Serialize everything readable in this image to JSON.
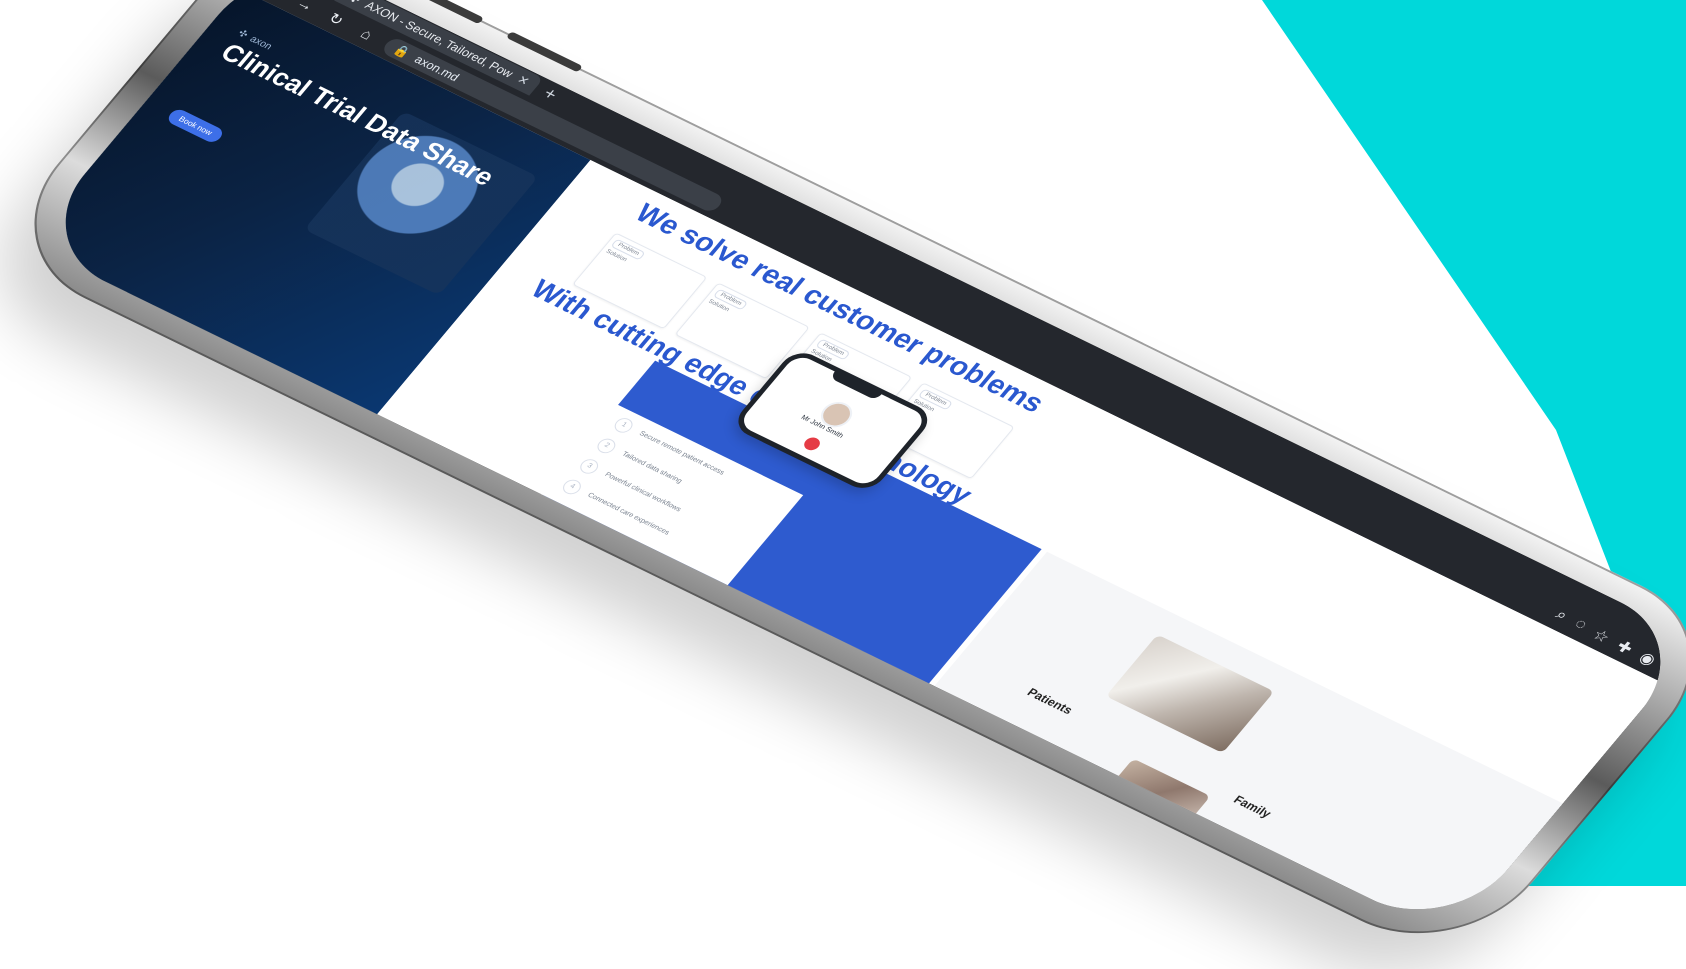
{
  "browser": {
    "tab_title": "AXON - Secure, Tailored, Pow",
    "url": "axon.md"
  },
  "hero": {
    "brand": "axon",
    "title": "Clinical Trial Data Share",
    "cta": "Book now"
  },
  "main": {
    "headline1": "We solve real customer problems",
    "headline2": "With cutting edge digital technology",
    "cards": [
      {
        "tag": "Problem",
        "label": "Solution"
      },
      {
        "tag": "Problem",
        "label": "Solution"
      },
      {
        "tag": "Problem",
        "label": "Solution"
      },
      {
        "tag": "Problem",
        "label": "Solution"
      }
    ],
    "features": [
      {
        "num": "1",
        "text": "Secure remote patient access"
      },
      {
        "num": "2",
        "text": "Tailored data sharing"
      },
      {
        "num": "3",
        "text": "Powerful clinical workflows"
      },
      {
        "num": "4",
        "text": "Connected care experiences"
      }
    ],
    "call": {
      "name": "Mr John Smith"
    }
  },
  "sections": {
    "patients": "Patients",
    "family": "Family"
  }
}
